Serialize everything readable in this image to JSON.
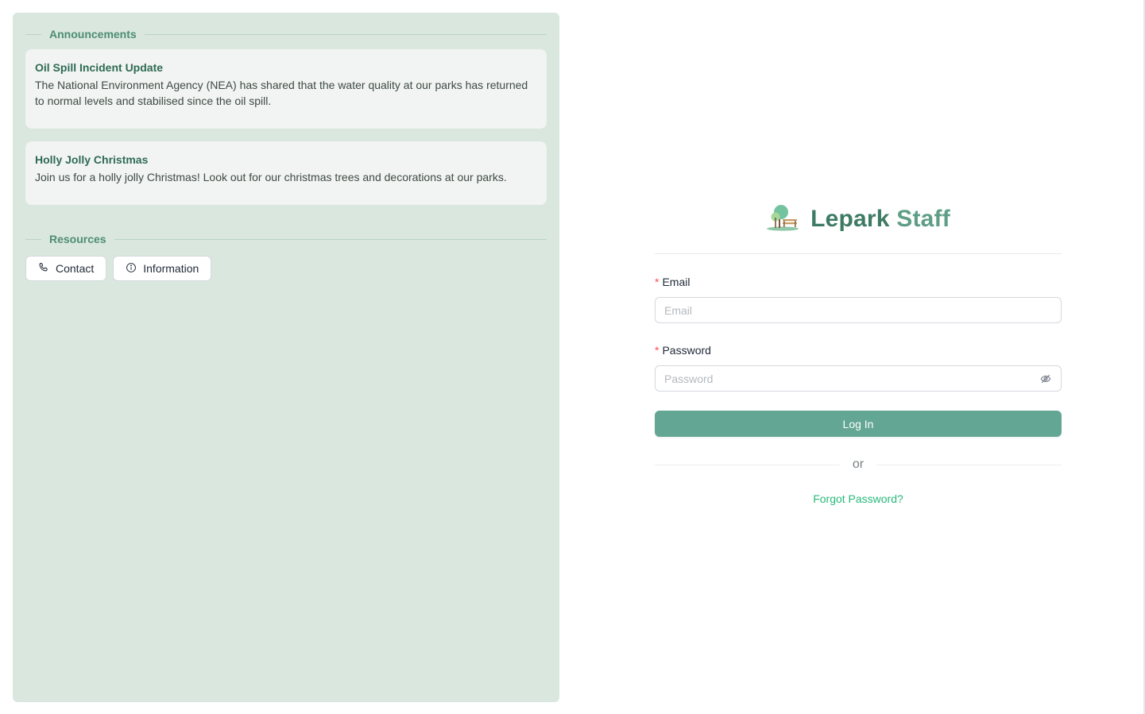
{
  "announcements": {
    "title": "Announcements",
    "items": [
      {
        "title": "Oil Spill Incident Update",
        "body": "The National Environment Agency (NEA) has shared that the water quality at our parks has returned to normal levels and stabilised since the oil spill."
      },
      {
        "title": "Holly Jolly Christmas",
        "body": "Join us for a holly jolly Christmas! Look out for our christmas trees and decorations at our parks."
      }
    ]
  },
  "resources": {
    "title": "Resources",
    "buttons": [
      {
        "label": "Contact",
        "icon": "phone-icon"
      },
      {
        "label": "Information",
        "icon": "info-circle-icon"
      }
    ]
  },
  "login": {
    "brand_primary": "Lepark",
    "brand_secondary": "Staff",
    "logo_icon": "park-bench-tree-icon",
    "email_label": "Email",
    "email_placeholder": "Email",
    "password_label": "Password",
    "password_placeholder": "Password",
    "password_toggle_icon": "eye-invisible-icon",
    "submit_label": "Log In",
    "or_text": "or",
    "forgot_label": "Forgot Password?"
  },
  "colors": {
    "panel_bg": "#d9e7de",
    "accent": "#63a693",
    "link": "#27b879",
    "required": "#ff4d4f"
  }
}
